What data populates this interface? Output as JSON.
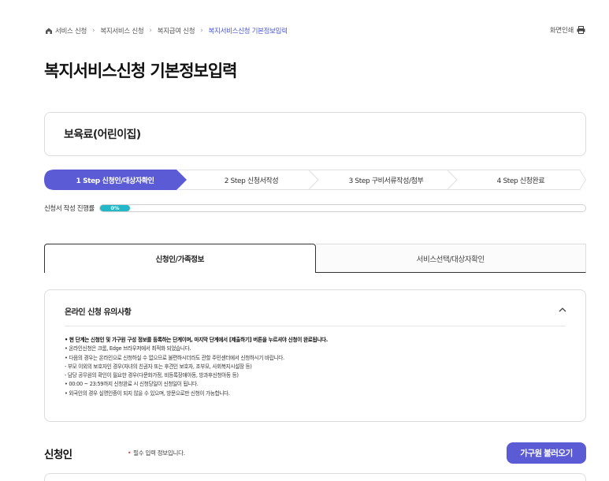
{
  "breadcrumb": {
    "items": [
      "서비스 신청",
      "복지서비스 신청",
      "복지급여 신청"
    ],
    "current": "복지서비스신청 기본정보입력"
  },
  "print_label": "화면인쇄",
  "page_title": "복지서비스신청 기본정보입력",
  "service_name": "보육료(어린이집)",
  "steps": [
    {
      "label": "1 Step 신청인/대상자확인",
      "active": true
    },
    {
      "label": "2 Step 신청서작성",
      "active": false
    },
    {
      "label": "3 Step 구비서류작성/첨부",
      "active": false
    },
    {
      "label": "4 Step 신청완료",
      "active": false
    }
  ],
  "progress": {
    "label": "신청서 작성 진행률",
    "value_text": "0%",
    "value": 0
  },
  "tabs": [
    {
      "label": "신청인/가족정보",
      "active": true
    },
    {
      "label": "서비스선택/대상자확인",
      "active": false
    }
  ],
  "notice": {
    "title": "온라인 신청 유의사항",
    "items": [
      "• 현 단계는 신청인 및 가구원 구성 정보를 등록하는 단계이며, 마지막 단계에서 [제출하기] 버튼을 누르셔야 신청이 완료됩니다.",
      "• 온라인신청은 크롬, Edge 브라우저에서 최적화 되었습니다.",
      "• 다음의 경우는 온라인으로 신청하실 수 없으므로 불편하시더라도 관할 주민센터에서 신청하시기 바랍니다.",
      "  - 부모 이외의 보호자인 경우(자녀의 친권자 또는 후견인 보호자, 조부모, 사회복지시설장 등)",
      "  - 담당 공무원의 확인이 필요한 경우(다문화가정, 비등록장애아동, 방과후신청아동 등)",
      "• 00:00 ~ 23:59까지 신청완료 시 신청당일이 신청일이 됩니다.",
      "• 외국인의 경우 실명인증이 되지 않을 수 있으며, 방문으로만 신청이 가능합니다."
    ]
  },
  "applicant": {
    "title": "신청인",
    "required_note": "필수 입력 정보입니다.",
    "required_mark": "•",
    "load_button": "가구원 불러오기"
  },
  "colors": {
    "accent": "#5b5bd6",
    "breadcrumb_current": "#4a56d8",
    "progress": "#23b7c7",
    "required": "#e03b3b"
  }
}
